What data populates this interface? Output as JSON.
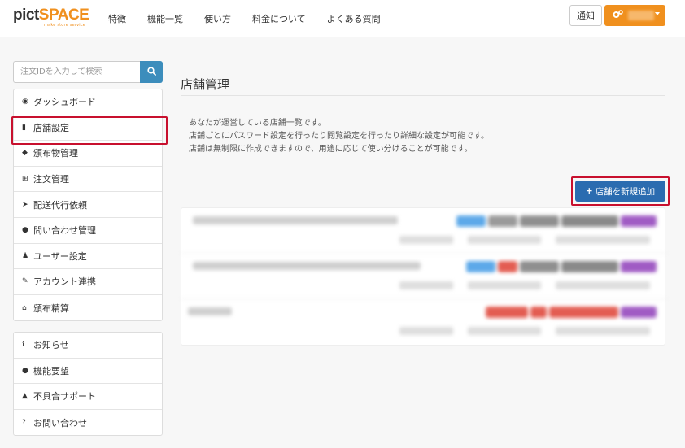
{
  "header": {
    "logo_pict": "pict",
    "logo_space": "SPACE",
    "logo_tagline": "make store service",
    "nav": [
      "特徴",
      "機能一覧",
      "使い方",
      "料金について",
      "よくある質問"
    ],
    "notice_label": "通知",
    "user_icon": "gears-icon"
  },
  "sidebar": {
    "search_placeholder": "注文IDを入力して検索",
    "search_icon": "search-icon",
    "menu_main": [
      {
        "label": "ダッシュボード",
        "icon": "dashboard-icon",
        "glyph": "◉"
      },
      {
        "label": "店舗設定",
        "icon": "store-icon",
        "glyph": "▮",
        "highlighted": true
      },
      {
        "label": "頒布物管理",
        "icon": "tag-icon",
        "glyph": "◆"
      },
      {
        "label": "注文管理",
        "icon": "cart-icon",
        "glyph": "⊞"
      },
      {
        "label": "配送代行依頼",
        "icon": "send-icon",
        "glyph": "➤"
      },
      {
        "label": "問い合わせ管理",
        "icon": "comments-icon",
        "glyph": "●"
      },
      {
        "label": "ユーザー設定",
        "icon": "user-icon",
        "glyph": "♟"
      },
      {
        "label": "アカウント連携",
        "icon": "wrench-icon",
        "glyph": "✎"
      },
      {
        "label": "頒布精算",
        "icon": "bank-icon",
        "glyph": "⌂"
      }
    ],
    "menu_sub": [
      {
        "label": "お知らせ",
        "icon": "info-icon",
        "glyph": "ℹ"
      },
      {
        "label": "機能要望",
        "icon": "comment-icon",
        "glyph": "●"
      },
      {
        "label": "不具合サポート",
        "icon": "warning-icon",
        "glyph": "▲"
      },
      {
        "label": "お問い合わせ",
        "icon": "question-icon",
        "glyph": "?"
      }
    ]
  },
  "main": {
    "title": "店舗管理",
    "description": [
      "あなたが運営している店舗一覧です。",
      "店舗ごとにパスワード設定を行ったり閲覧設定を行ったり詳細な設定が可能です。",
      "店舗は無制限に作成できますので、用途に応じて使い分けることが可能です。"
    ],
    "add_store_label": "店舗を新規追加"
  },
  "colors": {
    "brand_orange": "#f0901e",
    "primary_blue": "#2b6cb0",
    "search_blue": "#3c8dbc",
    "highlight_red": "#c8102e"
  }
}
